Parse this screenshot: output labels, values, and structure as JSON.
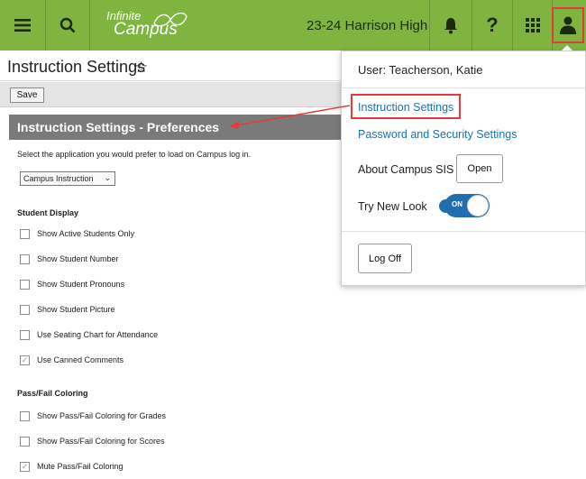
{
  "header": {
    "logo_line1": "Infinite",
    "logo_line2": "Campus",
    "school": "23-24 Harrison High",
    "icons": [
      "menu-icon",
      "search-icon",
      "bell-icon",
      "help-icon",
      "apps-grid-icon",
      "user-icon"
    ]
  },
  "page": {
    "title": "Instruction Settings",
    "save_label": "Save",
    "section_title": "Instruction Settings - Preferences",
    "hint": "Select the application you would prefer to load on Campus log in.",
    "app_select_value": "Campus Instruction"
  },
  "student_display": {
    "title": "Student Display",
    "items": [
      {
        "label": "Show Active Students Only",
        "checked": false
      },
      {
        "label": "Show Student Number",
        "checked": false
      },
      {
        "label": "Show Student Pronouns",
        "checked": false
      },
      {
        "label": "Show Student Picture",
        "checked": false
      },
      {
        "label": "Use Seating Chart for Attendance",
        "checked": false
      },
      {
        "label": "Use Canned Comments",
        "checked": true
      }
    ]
  },
  "pass_fail": {
    "title": "Pass/Fail Coloring",
    "items": [
      {
        "label": "Show Pass/Fail Coloring for Grades",
        "checked": false
      },
      {
        "label": "Show Pass/Fail Coloring for Scores",
        "checked": false
      },
      {
        "label": "Mute Pass/Fail Coloring",
        "checked": true
      }
    ]
  },
  "user_menu": {
    "user": "User: Teacherson, Katie",
    "instruction_settings": "Instruction Settings",
    "password_settings": "Password and Security Settings",
    "about": "About Campus SIS",
    "open_label": "Open",
    "try_new_look": "Try New Look",
    "toggle_label": "ON",
    "log_off": "Log Off"
  },
  "colors": {
    "topbar": "#7fb441",
    "link": "#1f6fb0",
    "highlight": "#e23b3b",
    "section_header": "#7a7a7a"
  }
}
